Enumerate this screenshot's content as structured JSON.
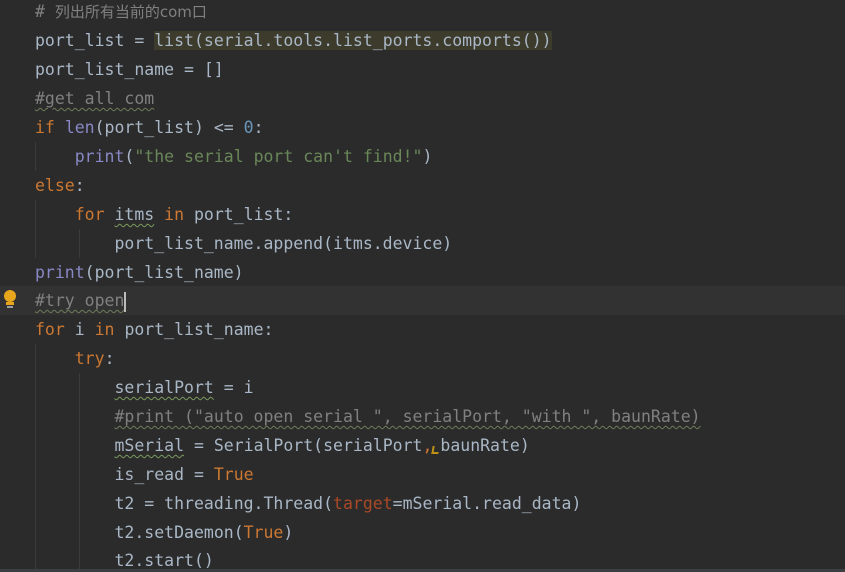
{
  "editor": {
    "language": "python",
    "lines": [
      {
        "t": "# ",
        "type": "comment"
      },
      {
        "t": "port_list = list(serial.tools.list_ports.comports())"
      },
      {
        "t": "port_list_name = []"
      },
      {
        "t": "#get all com",
        "type": "comment"
      },
      {
        "t": "if len(port_list) <= 0:"
      },
      {
        "t": "    print(\"the serial port can't find!\")"
      },
      {
        "t": "else:"
      },
      {
        "t": "    for itms in port_list:"
      },
      {
        "t": "        port_list_name.append(itms.device)"
      },
      {
        "t": "print(port_list_name)"
      },
      {
        "t": "#try open",
        "type": "comment",
        "current": true
      },
      {
        "t": "for i in port_list_name:"
      },
      {
        "t": "    try:"
      },
      {
        "t": "        serialPort = i"
      },
      {
        "t": "        #print (\"auto open serial \", serialPort, \"with \", baunRate)",
        "type": "comment"
      },
      {
        "t": "        mSerial = SerialPort(serialPort,baunRate)"
      },
      {
        "t": "        is_read = True"
      },
      {
        "t": "        t2 = threading.Thread(target=mSerial.read_data)"
      },
      {
        "t": "        t2.setDaemon(True)"
      },
      {
        "t": "        t2.start()"
      }
    ],
    "comment_header_cn": "列出所有当前的com口",
    "tokens": {
      "c0_hash": "# ",
      "c0_cn": "列出所有当前的com口",
      "l1_a": "port_list = ",
      "l1_call": "list(serial.tools.list_ports.comports())",
      "l2": "port_list_name = []",
      "l3": "#get all com",
      "l4_if": "if ",
      "l4_len": "len",
      "l4_mid": "(port_list) <= ",
      "l4_zero": "0",
      "l4_end": ":",
      "l5_indent": "    ",
      "l5_print": "print",
      "l5_open": "(",
      "l5_str": "\"the serial port can't find!\"",
      "l5_close": ")",
      "l6_else": "else",
      "l6_colon": ":",
      "l7_indent": "    ",
      "l7_for": "for ",
      "l7_itms": "itms",
      "l7_in": " in ",
      "l7_rest": "port_list:",
      "l8": "        port_list_name.append(itms.device)",
      "l9_print": "print",
      "l9_rest": "(port_list_name)",
      "l10": "#try open",
      "l11_for": "for ",
      "l11_i": "i ",
      "l11_in": "in ",
      "l11_rest": "port_list_name:",
      "l12_indent": "    ",
      "l12_try": "try",
      "l12_colon": ":",
      "l13_indent": "        ",
      "l13_var": "serialPort",
      "l13_rest": " = i",
      "l14_indent": "        ",
      "l14": "#print (\"auto open serial \", serialPort, \"with \", baunRate)",
      "l15_indent": "        ",
      "l15_var": "mSerial",
      "l15_mid": " = SerialPort(serialPort",
      "l15_comma": ",",
      "l15_rest": "baunRate)",
      "l16_indent": "        ",
      "l16_a": "is_read = ",
      "l16_true": "True",
      "l17_indent": "        ",
      "l17_a": "t2 = threading.Thread(",
      "l17_kw": "target",
      "l17_rest": "=mSerial.read_data)",
      "l18_indent": "        ",
      "l18_a": "t2.setDaemon(",
      "l18_true": "True",
      "l18_close": ")",
      "l19": "        t2.start()"
    }
  },
  "colors": {
    "background": "#2b2b2b",
    "current_line": "#323232",
    "default_text": "#a9b7c6",
    "keyword": "#cc7832",
    "string": "#6a8759",
    "number": "#6897bb",
    "builtin": "#8888c6",
    "comment": "#808080",
    "keyword_argument": "#aa4926",
    "call_highlight": "#3d3b2c",
    "bulb": "#e8a61d"
  },
  "icons": {
    "gutter_bulb": "lightbulb-icon"
  }
}
